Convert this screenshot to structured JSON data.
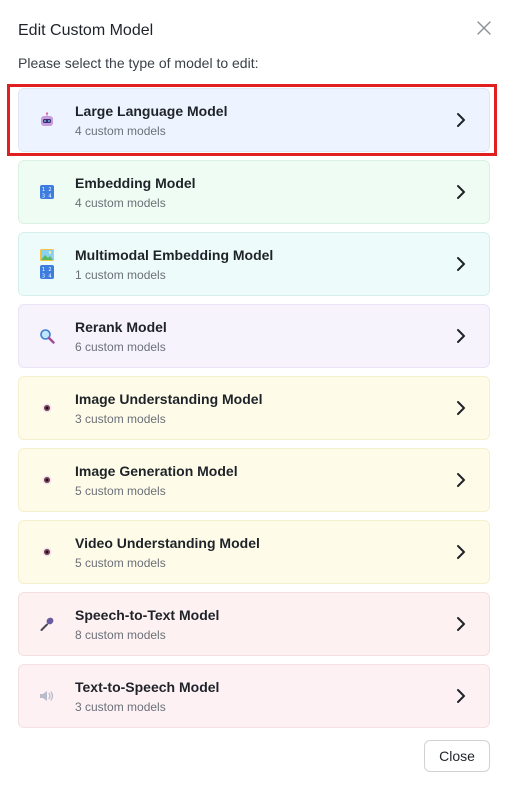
{
  "dialog": {
    "title": "Edit Custom Model",
    "subtitle": "Please select the type of model to edit:",
    "close_label": "Close"
  },
  "cards": [
    {
      "name": "Large Language Model",
      "count": "4 custom models",
      "icon": "robot-icon",
      "bg": "#eef4ff",
      "border": "#dfe7f7"
    },
    {
      "name": "Embedding Model",
      "count": "4 custom models",
      "icon": "numbers-icon",
      "bg": "#eefcf3",
      "border": "#d9f2e1"
    },
    {
      "name": "Multimodal Embedding Model",
      "count": "1 custom models",
      "icon": "image-numbers-icon",
      "bg": "#edfbfa",
      "border": "#d6f0ee"
    },
    {
      "name": "Rerank Model",
      "count": "6 custom models",
      "icon": "magnifier-icon",
      "bg": "#f7f3fd",
      "border": "#ebe3f6"
    },
    {
      "name": "Image Understanding Model",
      "count": "3 custom models",
      "icon": "eye-icon",
      "bg": "#fefce9",
      "border": "#f4efcf"
    },
    {
      "name": "Image Generation Model",
      "count": "5 custom models",
      "icon": "eye-icon",
      "bg": "#fefce9",
      "border": "#f4efcf"
    },
    {
      "name": "Video Understanding Model",
      "count": "5 custom models",
      "icon": "eye-icon",
      "bg": "#fefce9",
      "border": "#f4efcf"
    },
    {
      "name": "Speech-to-Text Model",
      "count": "8 custom models",
      "icon": "microphone-icon",
      "bg": "#fdf1f1",
      "border": "#f5e0e0"
    },
    {
      "name": "Text-to-Speech Model",
      "count": "3 custom models",
      "icon": "speaker-icon",
      "bg": "#fdf1f4",
      "border": "#f5e0e6"
    }
  ],
  "selected_index": 0,
  "colors": {
    "selection_outline": "#e02020"
  }
}
